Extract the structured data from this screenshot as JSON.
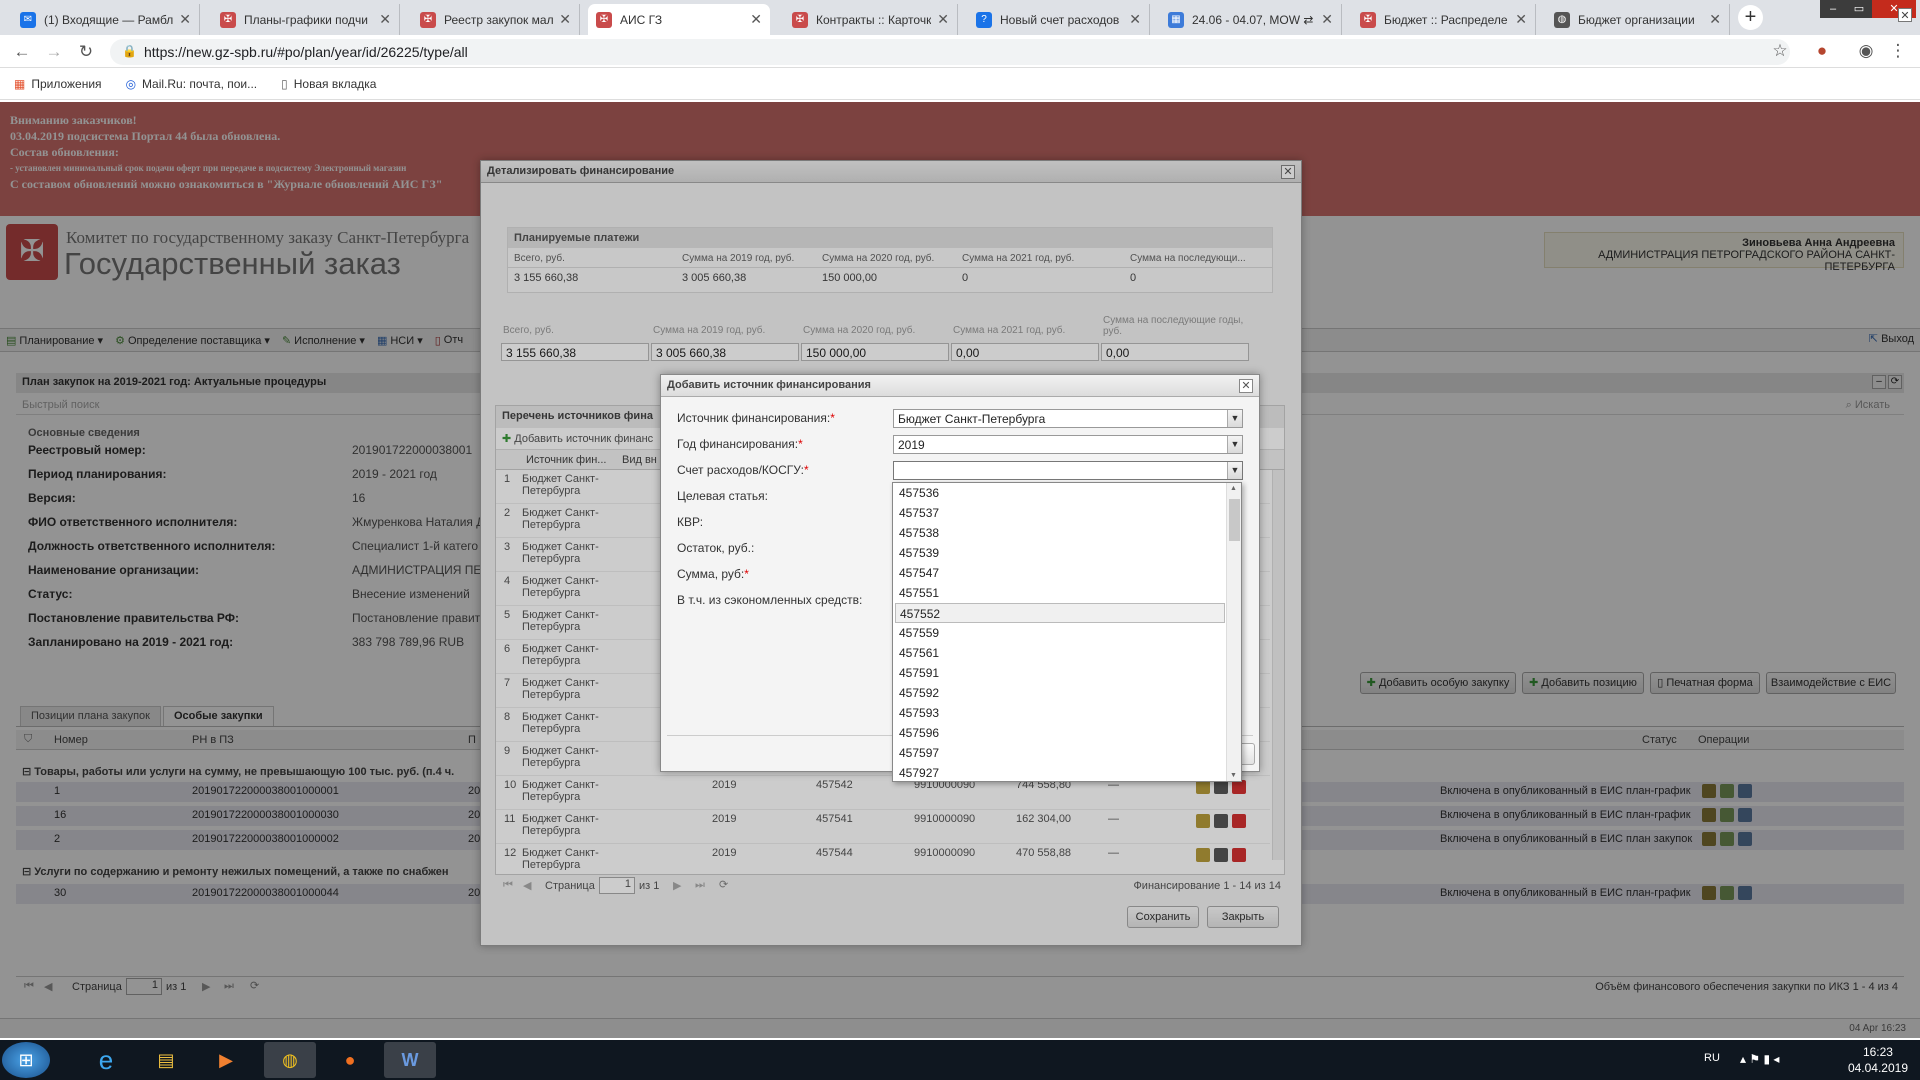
{
  "browser": {
    "tabs": [
      {
        "title": "(1) Входящие — Рамбл",
        "icon": "mail-icon",
        "color": "#1a73e8",
        "active": false
      },
      {
        "title": "Планы-графики подчи",
        "icon": "gz-logo-icon",
        "color": "#c94b4b",
        "active": false
      },
      {
        "title": "Реестр закупок малого",
        "icon": "gz-logo-icon",
        "color": "#c94b4b",
        "active": false
      },
      {
        "title": "АИС ГЗ",
        "icon": "gz-logo-icon",
        "color": "#c94b4b",
        "active": true
      },
      {
        "title": "Контракты :: Карточка",
        "icon": "gz-logo-icon",
        "color": "#c94b4b",
        "active": false
      },
      {
        "title": "Новый счет расходов",
        "icon": "help-icon",
        "color": "#1a73e8",
        "active": false
      },
      {
        "title": "24.06 - 04.07, MOW ⇄",
        "icon": "calendar-icon",
        "color": "#3d7bd9",
        "active": false
      },
      {
        "title": "Бюджет :: Распределе",
        "icon": "gz-logo-icon",
        "color": "#c94b4b",
        "active": false
      },
      {
        "title": "Бюджет организации",
        "icon": "globe-icon",
        "color": "#555555",
        "active": false
      }
    ],
    "url": "https://new.gz-spb.ru/#po/plan/year/id/26225/type/all",
    "bookmarks": [
      "Приложения",
      "Mail.Ru: почта, пои...",
      "Новая вкладка"
    ]
  },
  "banner": {
    "line1": "Вниманию заказчиков!",
    "line2": "03.04.2019 подсистема Портал 44 была обновлена.",
    "line3": "Состав обновления:",
    "line4": "- установлен минимальный срок подачи оферт при передаче в подсистему Электронный магазин",
    "line5": "С составом обновлений можно ознакомиться в \"Журнале обновлений АИС ГЗ\""
  },
  "header": {
    "org_line1": "Комитет по государственному заказу Санкт-Петербурга",
    "org_line2": "Государственный заказ",
    "user_name": "Зиновьева Анна Андреевна",
    "user_org": "АДМИНИСТРАЦИЯ ПЕТРОГРАДСКОГО РАЙОНА САНКТ-ПЕТЕРБУРГА"
  },
  "menu": {
    "items": [
      "Планирование ▾",
      "Определение поставщика ▾",
      "Исполнение ▾",
      "НСИ ▾",
      "Отч"
    ],
    "exit": "Выход"
  },
  "main": {
    "title": "План закупок на 2019-2021 год: Актуальные процедуры",
    "quick_search": "Быстрый поиск",
    "find": "Искать",
    "section": "Основные сведения",
    "info": [
      {
        "label": "Реестровый номер:",
        "value": "201901722000038001"
      },
      {
        "label": "Период планирования:",
        "value": "2019 - 2021 год"
      },
      {
        "label": "Версия:",
        "value": "16"
      },
      {
        "label": "ФИО ответственного исполнителя:",
        "value": "Жмуренкова Наталия Д"
      },
      {
        "label": "Должность ответственного исполнителя:",
        "value": "Специалист 1-й катего"
      },
      {
        "label": "Наименование организации:",
        "value": "АДМИНИСТРАЦИЯ ПЕТ"
      },
      {
        "label": "Статус:",
        "value": "Внесение изменений"
      },
      {
        "label": "Постановление правительства РФ:",
        "value": "Постановление правит"
      },
      {
        "label": "Запланировано на 2019 - 2021 год:",
        "value": "383 798 789,96 RUB"
      }
    ],
    "actions": [
      "Добавить особую закупку",
      "Добавить позицию",
      "Печатная форма",
      "Взаимодействие с ЕИС"
    ],
    "tabs": [
      "Позиции плана закупок",
      "Особые закупки"
    ],
    "grid_headers": [
      "Номер",
      "РН в ПЗ",
      "П",
      "Статус",
      "Операции"
    ],
    "group1": "Товары, работы или услуги на сумму, не превышающую 100 тыс. руб. (п.4 ч.",
    "group2": "Услуги по содержанию и ремонту нежилых помещений, а также по снабжен",
    "rows1": [
      {
        "num": "1",
        "rn": "201901722000038001000001",
        "p": "20",
        "status": "Включена в опубликованный в ЕИС план-график"
      },
      {
        "num": "16",
        "rn": "201901722000038001000030",
        "p": "20",
        "status": "Включена в опубликованный в ЕИС план-график"
      },
      {
        "num": "2",
        "rn": "201901722000038001000002",
        "p": "20",
        "status": "Включена в опубликованный в ЕИС план закупок"
      }
    ],
    "rows2": [
      {
        "num": "30",
        "rn": "201901722000038001000044",
        "p": "20",
        "status": "Включена в опубликованный в ЕИС план-график"
      }
    ],
    "pager": {
      "label": "Страница",
      "page": "1",
      "of": "из 1"
    },
    "footer_info": "Объём финансового обеспечения закупки по ИКЗ 1 - 4 из 4"
  },
  "status_bar": {
    "left": "",
    "right": "04 Apr 16:23"
  },
  "dialog1": {
    "title": "Детализировать финансирование",
    "planned_title": "Планируемые платежи",
    "planned_headers": [
      "Всего, руб.",
      "Сумма на 2019 год, руб.",
      "Сумма на 2020 год, руб.",
      "Сумма на 2021 год, руб.",
      "Сумма на последующи..."
    ],
    "planned_values": [
      "3 155 660,38",
      "3 005 660,38",
      "150 000,00",
      "0",
      "0"
    ],
    "sum_headers": [
      "Всего, руб.",
      "Сумма на 2019 год, руб.",
      "Сумма на 2020 год, руб.",
      "Сумма на 2021 год, руб.",
      "Сумма на последующие годы, руб."
    ],
    "sum_values": [
      "3 155 660,38",
      "3 005 660,38",
      "150 000,00",
      "0,00",
      "0,00"
    ],
    "sources_title": "Перечень источников фина",
    "add_source": "Добавить источник финанс",
    "grid_headers": [
      "Источник фин...",
      "Вид вн"
    ],
    "rows": [
      {
        "n": "1",
        "src": "Бюджет Санкт-Петербурга"
      },
      {
        "n": "2",
        "src": "Бюджет Санкт-Петербурга"
      },
      {
        "n": "3",
        "src": "Бюджет Санкт-Петербурга"
      },
      {
        "n": "4",
        "src": "Бюджет Санкт-Петербурга"
      },
      {
        "n": "5",
        "src": "Бюджет Санкт-Петербурга"
      },
      {
        "n": "6",
        "src": "Бюджет Санкт-Петербурга"
      },
      {
        "n": "7",
        "src": "Бюджет Санкт-Петербурга"
      },
      {
        "n": "8",
        "src": "Бюджет Санкт-Петербурга"
      },
      {
        "n": "9",
        "src": "Бюджет Санкт-Петербурга"
      },
      {
        "n": "10",
        "src": "Бюджет Санкт-Петербурга",
        "year": "2019",
        "kosgu": "457542",
        "kvr": "9910000090",
        "sum": "744 558,80",
        "dash": "—"
      },
      {
        "n": "11",
        "src": "Бюджет Санкт-Петербурга",
        "year": "2019",
        "kosgu": "457541",
        "kvr": "9910000090",
        "sum": "162 304,00",
        "dash": "—"
      },
      {
        "n": "12",
        "src": "Бюджет Санкт-Петербурга",
        "year": "2019",
        "kosgu": "457544",
        "kvr": "9910000090",
        "sum": "470 558,88",
        "dash": "—"
      }
    ],
    "pager": {
      "label": "Страница",
      "page": "1",
      "of": "из 1",
      "info": "Финансирование 1 - 14 из 14"
    },
    "save": "Сохранить",
    "close": "Закрыть"
  },
  "dialog2": {
    "title": "Добавить источник финансирования",
    "fields": [
      {
        "label": "Источник финансирования:",
        "required": true,
        "value": "Бюджет Санкт-Петербурга"
      },
      {
        "label": "Год финансирования:",
        "required": true,
        "value": "2019"
      },
      {
        "label": "Счет расходов/КОСГУ:",
        "required": true,
        "value": ""
      },
      {
        "label": "Целевая статья:",
        "required": false
      },
      {
        "label": "КВР:",
        "required": false
      },
      {
        "label": "Остаток, руб.:",
        "required": false
      },
      {
        "label": "Сумма, руб:",
        "required": true
      },
      {
        "label": "В т.ч. из сэкономленных средств:",
        "required": false
      }
    ],
    "dropdown_options": [
      "457536",
      "457537",
      "457538",
      "457539",
      "457547",
      "457551",
      "457552",
      "457559",
      "457561",
      "457591",
      "457592",
      "457593",
      "457596",
      "457597",
      "457927"
    ],
    "highlighted_option": "457552"
  },
  "taskbar": {
    "lang": "RU",
    "time": "16:23",
    "date": "04.04.2019"
  },
  "colors": {
    "banner": "#d9736f",
    "accent": "#c94b4b",
    "taskbar": "#0f1720"
  }
}
